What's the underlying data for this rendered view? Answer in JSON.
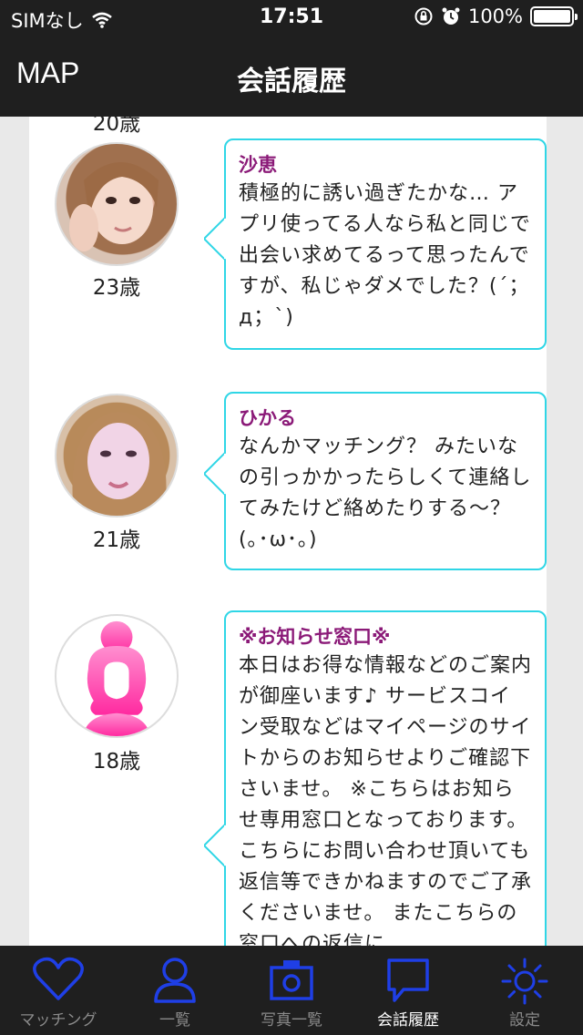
{
  "status_bar": {
    "carrier": "SIMなし",
    "time": "17:51",
    "battery": "100%",
    "battery_level": 1.0
  },
  "nav": {
    "left_label": "MAP",
    "title": "会話履歴"
  },
  "partial_age": "20歳",
  "conversations": [
    {
      "age": "23歳",
      "name": "沙恵",
      "message": "積極的に誘い過ぎたかな… アプリ使ってる人なら私と同じで出会い求めてるって思ったんですが、私じゃダメでした？(´；д；`)"
    },
    {
      "age": "21歳",
      "name": "ひかる",
      "message": "なんかマッチング？ みたいなの引っかかったらしくて連絡してみたけど絡めたりする〜？(｡･ω･｡)"
    },
    {
      "age": "18歳",
      "name": "※お知らせ窓口※",
      "message": "本日はお得な情報などのご案内が御座います♪ サービスコイン受取などはマイページのサイトからのお知らせよりご確認下さいませ。 ※こちらはお知らせ専用窓口となっております。 こちらにお問い合わせ頂いても返信等できかねますのでご了承くださいませ。 またこちらの窓口への返信に"
    }
  ],
  "tabs": [
    {
      "label": "マッチング",
      "icon": "heart-icon"
    },
    {
      "label": "一覧",
      "icon": "person-icon"
    },
    {
      "label": "写真一覧",
      "icon": "camera-icon"
    },
    {
      "label": "会話履歴",
      "icon": "speech-bubble-icon",
      "active": true
    },
    {
      "label": "設定",
      "icon": "sun-icon"
    }
  ],
  "colors": {
    "bar_background": "#1f1f1f",
    "bubble_border": "#2fd6e6",
    "name_color": "#8b1a78",
    "tab_icon_blue": "#1f3fe6",
    "avatar_pink": "#ff3fa6"
  }
}
